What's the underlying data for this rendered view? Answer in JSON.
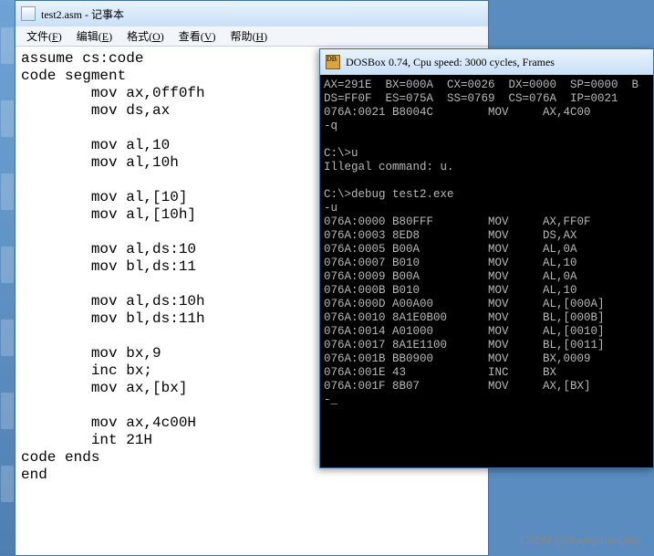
{
  "notepad": {
    "title": "test2.asm - 记事本",
    "menu": [
      {
        "label": "文件",
        "accel": "F"
      },
      {
        "label": "编辑",
        "accel": "E"
      },
      {
        "label": "格式",
        "accel": "O"
      },
      {
        "label": "查看",
        "accel": "V"
      },
      {
        "label": "帮助",
        "accel": "H"
      }
    ],
    "code": "assume cs:code\ncode segment\n        mov ax,0ff0fh\n        mov ds,ax\n\n        mov al,10\n        mov al,10h\n\n        mov al,[10]\n        mov al,[10h]\n\n        mov al,ds:10\n        mov bl,ds:11\n\n        mov al,ds:10h\n        mov bl,ds:11h\n\n        mov bx,9\n        inc bx;\n        mov ax,[bx]\n\n        mov ax,4c00H\n        int 21H\ncode ends\nend"
  },
  "dosbox": {
    "title": "DOSBox 0.74, Cpu speed:    3000 cycles, Frames",
    "registers": {
      "AX": "291E",
      "BX": "000A",
      "CX": "0026",
      "DX": "0000",
      "SP": "0000",
      "B": "",
      "DS": "FF0F",
      "ES": "075A",
      "SS": "0769",
      "CS": "076A",
      "IP": "0021"
    },
    "trace_line": "076A:0021 B8004C        MOV     AX,4C00",
    "prompt_q": "-q",
    "prompt1": "C:\\>u",
    "illegal": "Illegal command: u.",
    "empty_line": "",
    "prompt2": "C:\\>debug test2.exe",
    "u_cmd": "-u",
    "disasm": [
      {
        "addr": "076A:0000",
        "bytes": "B80FFF",
        "mnem": "MOV",
        "ops": "AX,FF0F"
      },
      {
        "addr": "076A:0003",
        "bytes": "8ED8",
        "mnem": "MOV",
        "ops": "DS,AX"
      },
      {
        "addr": "076A:0005",
        "bytes": "B00A",
        "mnem": "MOV",
        "ops": "AL,0A"
      },
      {
        "addr": "076A:0007",
        "bytes": "B010",
        "mnem": "MOV",
        "ops": "AL,10"
      },
      {
        "addr": "076A:0009",
        "bytes": "B00A",
        "mnem": "MOV",
        "ops": "AL,0A"
      },
      {
        "addr": "076A:000B",
        "bytes": "B010",
        "mnem": "MOV",
        "ops": "AL,10"
      },
      {
        "addr": "076A:000D",
        "bytes": "A00A00",
        "mnem": "MOV",
        "ops": "AL,[000A]"
      },
      {
        "addr": "076A:0010",
        "bytes": "8A1E0B00",
        "mnem": "MOV",
        "ops": "BL,[000B]"
      },
      {
        "addr": "076A:0014",
        "bytes": "A01000",
        "mnem": "MOV",
        "ops": "AL,[0010]"
      },
      {
        "addr": "076A:0017",
        "bytes": "8A1E1100",
        "mnem": "MOV",
        "ops": "BL,[0011]"
      },
      {
        "addr": "076A:001B",
        "bytes": "BB0900",
        "mnem": "MOV",
        "ops": "BX,0009"
      },
      {
        "addr": "076A:001E",
        "bytes": "43",
        "mnem": "INC",
        "ops": "BX"
      },
      {
        "addr": "076A:001F",
        "bytes": "8B07",
        "mnem": "MOV",
        "ops": "AX,[BX]"
      }
    ],
    "cursor": "-_"
  },
  "watermark": "CSDN @zhangzhangkeji"
}
